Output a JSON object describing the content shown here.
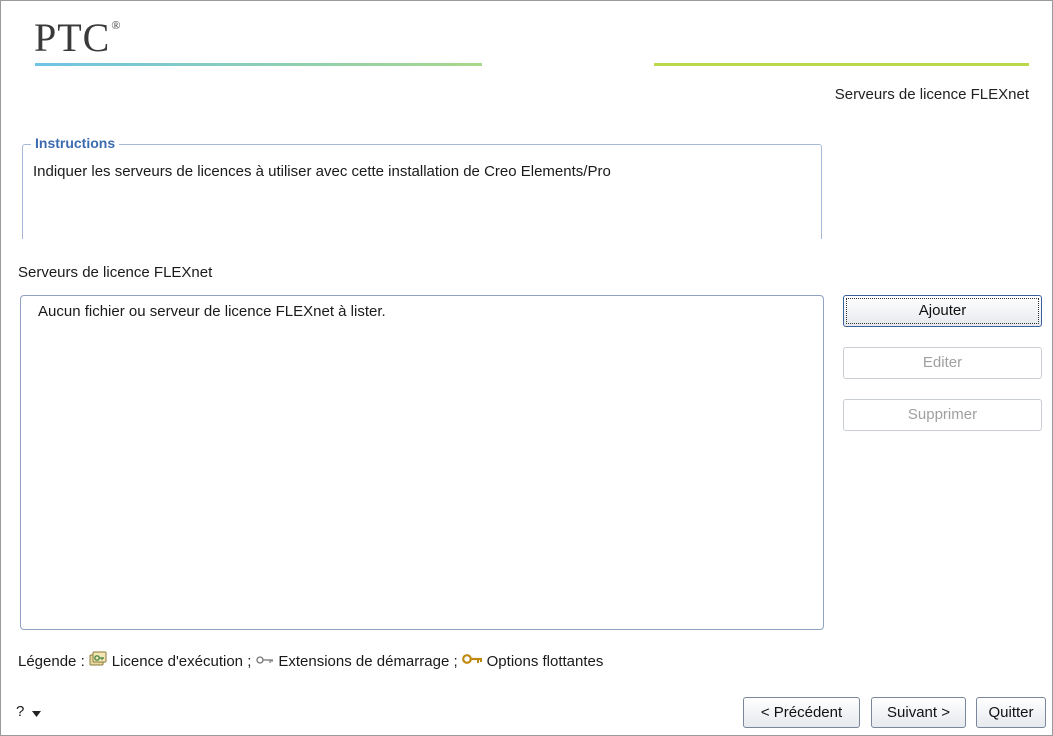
{
  "header": {
    "logo": "PTC",
    "logo_mark": "®",
    "page_title": "Serveurs de licence FLEXnet",
    "accent_left": "#6fc3e6",
    "accent_right": "#b9d84a"
  },
  "instructions": {
    "legend": "Instructions",
    "text": "Indiquer les serveurs de licences à utiliser avec cette installation de Creo Elements/Pro"
  },
  "servers": {
    "label": "Serveurs de licence FLEXnet",
    "empty_message": "Aucun fichier ou serveur de licence FLEXnet à lister."
  },
  "actions": {
    "add": "Ajouter",
    "edit": "Editer",
    "delete": "Supprimer"
  },
  "legend": {
    "prefix": "Légende :",
    "runtime": "Licence d'exécution ;",
    "startup": "Extensions de démarrage ;",
    "floating": "Options flottantes",
    "icons": [
      "runtime-license-icon",
      "startup-extension-key-icon",
      "floating-option-key-icon"
    ]
  },
  "footer": {
    "help": "?",
    "previous": "< Précédent",
    "next": "Suivant >",
    "quit": "Quitter"
  }
}
